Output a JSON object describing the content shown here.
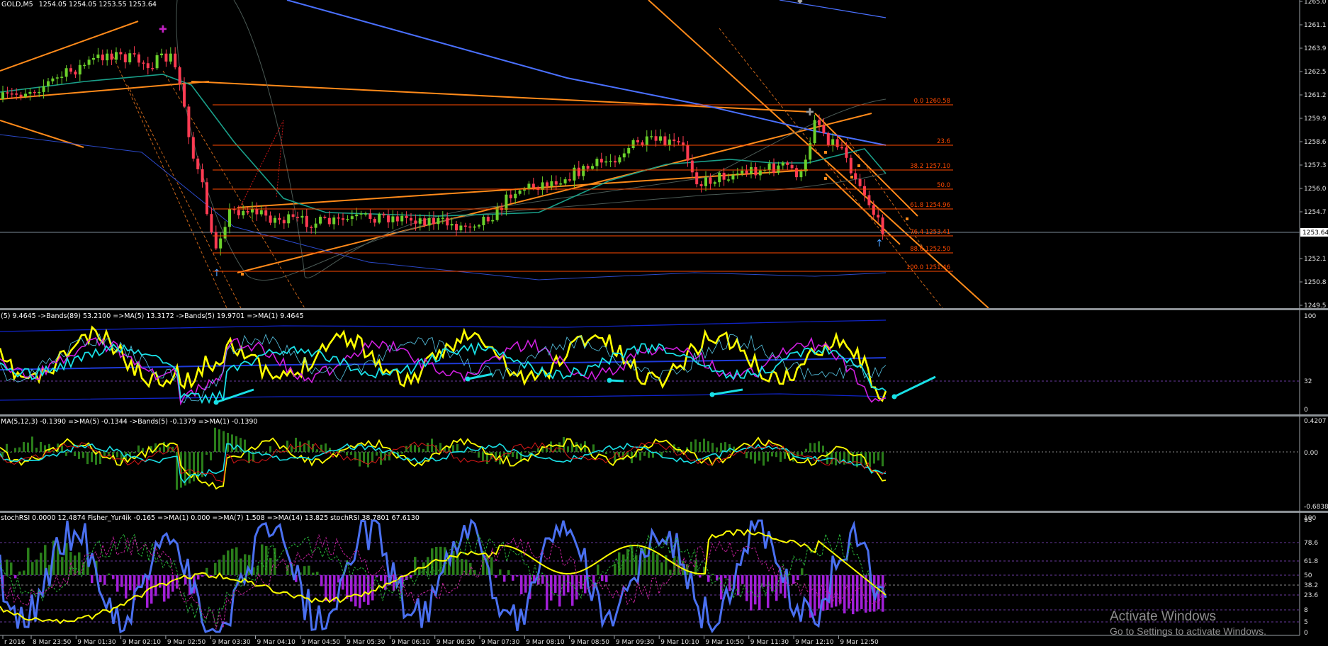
{
  "app": {
    "chart_label": "GOLD,M5",
    "ohlc": "1254.05 1254.05 1253.55 1253.64"
  },
  "colors": {
    "background": "#000000",
    "bull_candle": "#6bd12b",
    "bear_candle": "#ff3b52",
    "channel": "#ff8a1a",
    "fib": "#ff4a00",
    "ma_blue": "#4a70ff",
    "teal": "#1aa08a",
    "yellow": "#ffff00",
    "cyan": "#19e0e6",
    "magenta": "#d01fe0",
    "green_hist": "#2a7d1a",
    "purple_hist": "#a21fd8",
    "separator": "#9aa0a6",
    "axis_text": "#e4e4e4"
  },
  "price_axis": {
    "ticks": [
      "1264.0",
      "1263.15",
      "1262.35",
      "1261.55",
      "1260.75",
      "1259.95",
      "1258.65",
      "1257.35",
      "1256.05",
      "1254.75",
      "1253.45",
      "1252.15",
      "1250.85",
      "1249.55"
    ],
    "ticks_shown": [
      "1265.0",
      "1261.1",
      "1263.9",
      "1262.5",
      "1261.2",
      "1259.9",
      "1258.6",
      "1257.3",
      "1256.0",
      "1254.7",
      "1253.64",
      "1252.1",
      "1250.8",
      "1249.5"
    ],
    "current": "1253.64"
  },
  "fib_levels": [
    {
      "label": "0.0 1260.58"
    },
    {
      "label": "23.6"
    },
    {
      "label": "38.2 1257.10"
    },
    {
      "label": "50.0"
    },
    {
      "label": "61.8 1254.96"
    },
    {
      "label": "76.4 1253.41"
    },
    {
      "label": "88.6 1252.50"
    },
    {
      "label": "100.0 1251.46"
    }
  ],
  "panel1": {
    "label": "(5) 9.4645  ->Bands(89) 53.2100  =>MA(5) 13.3172  ->Bands(5) 19.9701  =>MA(1) 9.4645",
    "scale": [
      "100",
      "32",
      "0"
    ]
  },
  "panel2": {
    "label": "MA(5,12,3) -0.1390  =>MA(5) -0.1344  ->Bands(5) -0.1379  =>MA(1) -0.1390",
    "scale": [
      "0.4207",
      "0.00",
      "-0.6838"
    ]
  },
  "panel3": {
    "label": "stochRSI 0.0000 12.4874  Fisher_Yur4ik -0.165  =>MA(1) 0.000  =>MA(7) 1.508  =>MA(14) 13.825  stochRSI 38.7801 67.6130",
    "scale": [
      "100",
      "95",
      "78.6",
      "61.8",
      "50",
      "38.2",
      "23.6",
      "8",
      "5",
      "0"
    ]
  },
  "time_axis": [
    "r 2016",
    "8 Mar 23:50",
    "9 Mar 01:30",
    "9 Mar 02:10",
    "9 Mar 02:50",
    "9 Mar 03:30",
    "9 Mar 04:10",
    "9 Mar 04:50",
    "9 Mar 05:30",
    "9 Mar 06:10",
    "9 Mar 06:50",
    "9 Mar 07:30",
    "9 Mar 08:10",
    "9 Mar 08:50",
    "9 Mar 09:30",
    "9 Mar 10:10",
    "9 Mar 10:50",
    "9 Mar 11:30",
    "9 Mar 12:10",
    "9 Mar 12:50"
  ],
  "watermark": {
    "title": "Activate Windows",
    "subtitle": "Go to Settings to activate Windows."
  }
}
